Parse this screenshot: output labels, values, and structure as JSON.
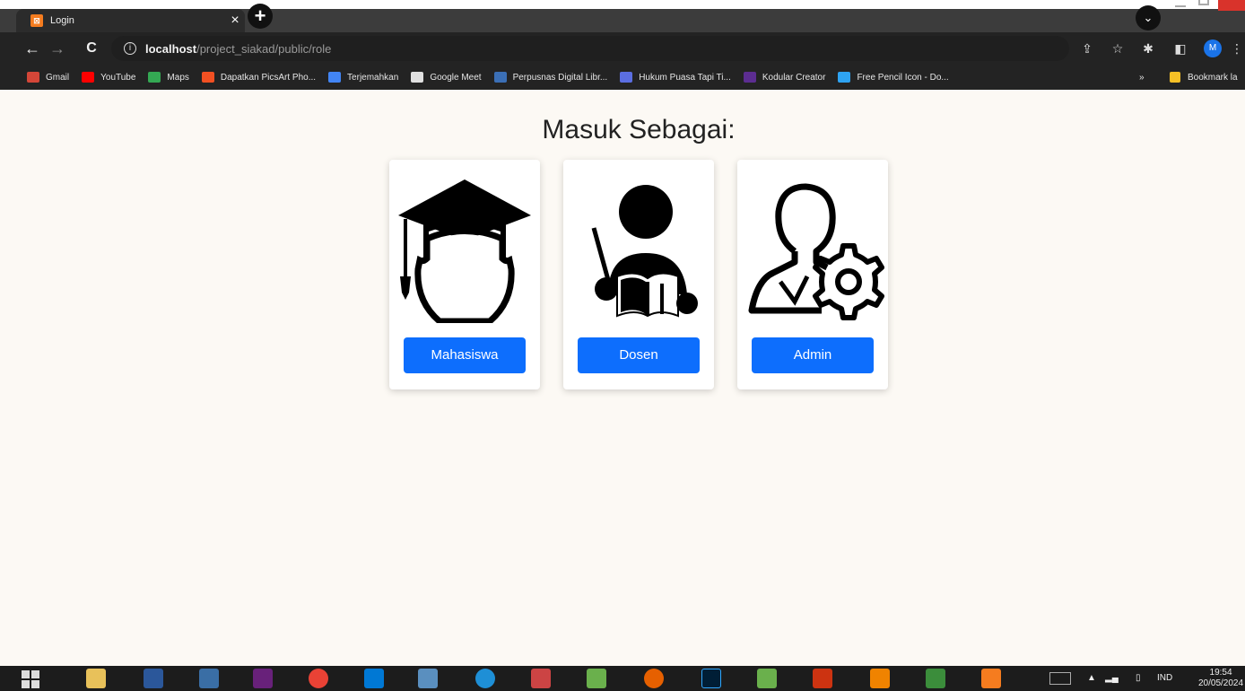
{
  "browser": {
    "tab_title": "Login",
    "tab_close": "×",
    "new_tab": "+",
    "url_host": "localhost",
    "url_path": "/project_siakad/public/role",
    "back": "←",
    "forward": "→",
    "reload": "C",
    "profile_initial": "M"
  },
  "bookmarks": [
    {
      "label": "Gmail",
      "color": "#d44638"
    },
    {
      "label": "YouTube",
      "color": "#ff0000"
    },
    {
      "label": "Maps",
      "color": "#34a853"
    },
    {
      "label": "Dapatkan PicsArt Pho...",
      "color": "#f25022"
    },
    {
      "label": "Terjemahkan",
      "color": "#4285f4"
    },
    {
      "label": "Google Meet",
      "color": "#e0e0e0"
    },
    {
      "label": "Perpusnas Digital Libr...",
      "color": "#3b6fb6"
    },
    {
      "label": "Hukum Puasa Tapi Ti...",
      "color": "#5b6ee1"
    },
    {
      "label": "Kodular Creator",
      "color": "#5c2d91"
    },
    {
      "label": "Free Pencil Icon - Do...",
      "color": "#2ea3f2"
    }
  ],
  "bookmarks_more": "»",
  "bookmarks_folder": "Bookmark la",
  "page": {
    "heading": "Masuk Sebagai:",
    "roles": [
      {
        "label": "Mahasiswa",
        "icon": "graduate-icon"
      },
      {
        "label": "Dosen",
        "icon": "teacher-icon"
      },
      {
        "label": "Admin",
        "icon": "admin-gear-icon"
      }
    ]
  },
  "taskbar": {
    "lang": "IND",
    "time": "19:54",
    "date": "20/05/2024"
  },
  "colors": {
    "primary_button": "#0d6efd",
    "page_bg": "#fcf9f4"
  }
}
